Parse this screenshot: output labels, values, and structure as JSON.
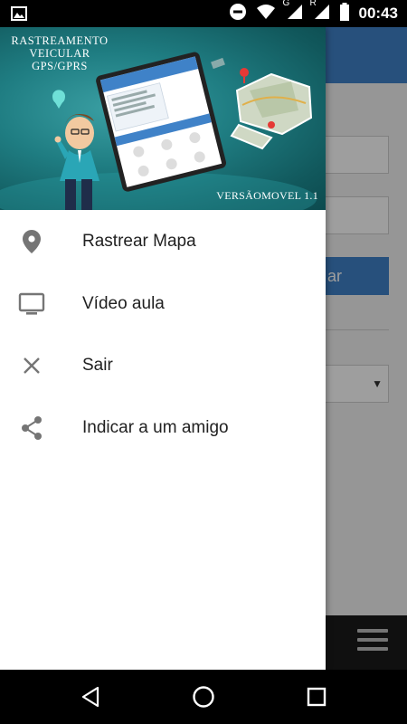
{
  "status_bar": {
    "time": "00:43",
    "icons": [
      "image-icon",
      "do-not-disturb-icon",
      "wifi-icon",
      "signal-g-icon",
      "signal-r-icon",
      "battery-icon"
    ],
    "network_g": "G",
    "network_r": "R"
  },
  "drawer": {
    "header": {
      "title_line1": "RASTREAMENTO",
      "title_line2": "VEICULAR",
      "title_line3": "GPS/GPRS",
      "version": "VERSÃOMOVEL 1.1"
    },
    "items": [
      {
        "label": "Rastrear Mapa",
        "icon": "map-pin-icon"
      },
      {
        "label": "Vídeo aula",
        "icon": "tv-icon"
      },
      {
        "label": "Sair",
        "icon": "close-icon"
      },
      {
        "label": "Indicar a um amigo",
        "icon": "share-icon"
      }
    ]
  },
  "background_app": {
    "button_partial": "ar",
    "toolbar_color": "#3f82c8",
    "bottom_bar_color": "#1a1a1a"
  },
  "nav_bar": {
    "buttons": [
      "back-icon",
      "home-icon",
      "recents-icon"
    ]
  },
  "colors": {
    "accent": "#3f82c8",
    "header_teal": "#1f7d82",
    "icon_gray": "#757575",
    "text": "#212121"
  }
}
